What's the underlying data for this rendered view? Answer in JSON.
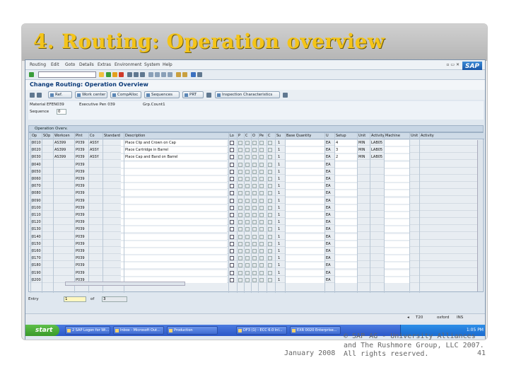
{
  "slide": {
    "title": "4. Routing: Operation overview",
    "footer_date": "January 2008",
    "footer_copyright": "© SAP AG - University Alliances and The Rushmore Group, LLC 2007. All rights reserved.",
    "page_number": "41"
  },
  "sap": {
    "menu": [
      "Routing",
      "Edit",
      "Goto",
      "Details",
      "Extras",
      "Environment",
      "System",
      "Help"
    ],
    "logo": "SAP",
    "screen_title": "Change Routing: Operation Overview",
    "app_buttons": [
      "Ref.",
      "Work center",
      "CompAlloc",
      "Sequences",
      "PRT",
      "Inspection Characteristics"
    ],
    "header": {
      "material_label": "Material",
      "material_value": "EFEN039",
      "material_desc": "Executive Pen 039",
      "grp_count_label": "Grp.Count1",
      "sequence_label": "Sequence",
      "sequence_value": "0"
    },
    "table_title": "Operation Overv.",
    "columns": [
      "Op",
      "SOp",
      "Workcen",
      "Plnt",
      "Co",
      "Standard",
      "Description",
      "Lo",
      "P",
      "C",
      "O",
      "Pe",
      "C",
      "Su",
      "Base Quantity",
      "U",
      "Setup",
      "Unit",
      "Activity",
      "Machine",
      "Unit",
      "Activity"
    ],
    "rows": [
      {
        "op": "0010",
        "wc": "AS399",
        "plnt": "P039",
        "co": "ASSY",
        "desc": "Place Clip and Crown on Cap",
        "cs": "1",
        "un": "EA",
        "setup": "4",
        "unit": "MIN",
        "act": "LAB05"
      },
      {
        "op": "0020",
        "wc": "AS399",
        "plnt": "P039",
        "co": "ASSY",
        "desc": "Place Cartridge in Barrel",
        "cs": "1",
        "un": "EA",
        "setup": "3",
        "unit": "MIN",
        "act": "LAB05"
      },
      {
        "op": "0030",
        "wc": "AS399",
        "plnt": "P039",
        "co": "ASSY",
        "desc": "Place Cap and Band on Barrel",
        "cs": "1",
        "un": "EA",
        "setup": "2",
        "unit": "MIN",
        "act": "LAB05"
      },
      {
        "op": "0040",
        "wc": "",
        "plnt": "P039",
        "co": "",
        "desc": "",
        "cs": "1",
        "un": "EA",
        "setup": "",
        "unit": "",
        "act": ""
      },
      {
        "op": "0050",
        "wc": "",
        "plnt": "P039",
        "co": "",
        "desc": "",
        "cs": "1",
        "un": "EA",
        "setup": "",
        "unit": "",
        "act": ""
      },
      {
        "op": "0060",
        "wc": "",
        "plnt": "P039",
        "co": "",
        "desc": "",
        "cs": "1",
        "un": "EA",
        "setup": "",
        "unit": "",
        "act": ""
      },
      {
        "op": "0070",
        "wc": "",
        "plnt": "P039",
        "co": "",
        "desc": "",
        "cs": "1",
        "un": "EA",
        "setup": "",
        "unit": "",
        "act": ""
      },
      {
        "op": "0080",
        "wc": "",
        "plnt": "P039",
        "co": "",
        "desc": "",
        "cs": "1",
        "un": "EA",
        "setup": "",
        "unit": "",
        "act": ""
      },
      {
        "op": "0090",
        "wc": "",
        "plnt": "P039",
        "co": "",
        "desc": "",
        "cs": "1",
        "un": "EA",
        "setup": "",
        "unit": "",
        "act": ""
      },
      {
        "op": "0100",
        "wc": "",
        "plnt": "P039",
        "co": "",
        "desc": "",
        "cs": "1",
        "un": "EA",
        "setup": "",
        "unit": "",
        "act": ""
      },
      {
        "op": "0110",
        "wc": "",
        "plnt": "P039",
        "co": "",
        "desc": "",
        "cs": "1",
        "un": "EA",
        "setup": "",
        "unit": "",
        "act": ""
      },
      {
        "op": "0120",
        "wc": "",
        "plnt": "P039",
        "co": "",
        "desc": "",
        "cs": "1",
        "un": "EA",
        "setup": "",
        "unit": "",
        "act": ""
      },
      {
        "op": "0130",
        "wc": "",
        "plnt": "P039",
        "co": "",
        "desc": "",
        "cs": "1",
        "un": "EA",
        "setup": "",
        "unit": "",
        "act": ""
      },
      {
        "op": "0140",
        "wc": "",
        "plnt": "P039",
        "co": "",
        "desc": "",
        "cs": "1",
        "un": "EA",
        "setup": "",
        "unit": "",
        "act": ""
      },
      {
        "op": "0150",
        "wc": "",
        "plnt": "P039",
        "co": "",
        "desc": "",
        "cs": "1",
        "un": "EA",
        "setup": "",
        "unit": "",
        "act": ""
      },
      {
        "op": "0160",
        "wc": "",
        "plnt": "P039",
        "co": "",
        "desc": "",
        "cs": "1",
        "un": "EA",
        "setup": "",
        "unit": "",
        "act": ""
      },
      {
        "op": "0170",
        "wc": "",
        "plnt": "P039",
        "co": "",
        "desc": "",
        "cs": "1",
        "un": "EA",
        "setup": "",
        "unit": "",
        "act": ""
      },
      {
        "op": "0180",
        "wc": "",
        "plnt": "P039",
        "co": "",
        "desc": "",
        "cs": "1",
        "un": "EA",
        "setup": "",
        "unit": "",
        "act": ""
      },
      {
        "op": "0190",
        "wc": "",
        "plnt": "P039",
        "co": "",
        "desc": "",
        "cs": "1",
        "un": "EA",
        "setup": "",
        "unit": "",
        "act": ""
      },
      {
        "op": "0200",
        "wc": "",
        "plnt": "P039",
        "co": "",
        "desc": "",
        "cs": "1",
        "un": "EA",
        "setup": "",
        "unit": "",
        "act": ""
      }
    ],
    "entry_label": "Entry",
    "entry_value": "1",
    "entry_of": "of",
    "entry_total": "3",
    "status": {
      "session": "T20",
      "server": "oxford",
      "mode": "INS"
    },
    "taskbar": {
      "start": "start",
      "tasks": [
        "2 SAP Logon for Wi...",
        "Inbox - Microsoft Out...",
        "Production",
        "DF3 (1) - ECC 6.0 Inl...",
        "EXR 0020 Enterprise..."
      ],
      "clock": "1:05 PM"
    },
    "colors": {
      "title_gold": "#f4c419",
      "sap_blue": "#0b3a78",
      "taskbar": "#2a57c8"
    }
  }
}
